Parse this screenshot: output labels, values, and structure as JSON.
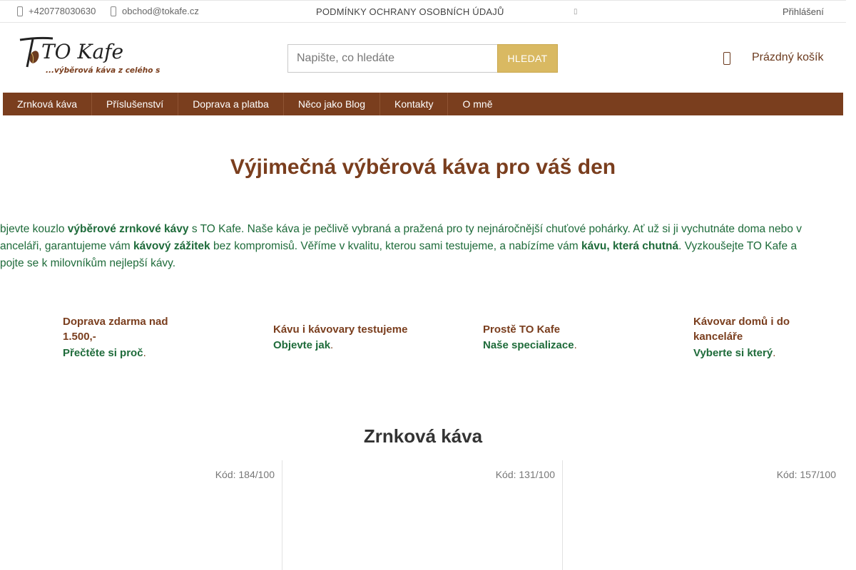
{
  "topbar": {
    "phone": "+420778030630",
    "email": "obchod@tokafe.cz",
    "privacy_link": "PODMÍNKY OCHRANY OSOBNÍCH ÚDAJŮ",
    "extra_icon": "▯",
    "login": "Přihlášení"
  },
  "header": {
    "logo_text": "TO Kafe",
    "logo_tagline": "...výběrová káva z celého světa",
    "search_placeholder": "Napište, co hledáte",
    "search_button": "HLEDAT",
    "cart_label": "Prázdný košík"
  },
  "nav": {
    "items": [
      "Zrnková káva",
      "Příslušenství",
      "Doprava a platba",
      "Něco jako Blog",
      "Kontakty",
      "O mně"
    ]
  },
  "hero": {
    "title": "Výjimečná výběrová káva pro váš den",
    "line1_a": "bjevte kouzlo ",
    "line1_b": "výběrové zrnkové kávy",
    "line1_c": " s TO Kafe. Naše káva je pečlivě vybraná a pražená pro ty nejnáročnější chuťové pohárky. Ať už si ji vychutnáte doma nebo v",
    "line2_a": "anceláři, garantujeme vám ",
    "line2_b": "kávový zážitek",
    "line2_c": " bez kompromisů. Věříme v kvalitu, kterou sami testujeme, a nabízíme vám ",
    "line2_d": "kávu, která chutná",
    "line2_e": ". Vyzkoušejte TO Kafe a",
    "line3": "pojte se k milovníkům nejlepší kávy."
  },
  "benefits": [
    {
      "title_1": "Doprava zdarma nad",
      "title_2": "1.500,-",
      "link": "Přečtěte si proč",
      "suffix": "."
    },
    {
      "title_1": "Kávu i kávovary testujeme",
      "link": "Objevte jak",
      "suffix": "."
    },
    {
      "title_1": "Prostě TO Kafe",
      "link": "Naše specializace",
      "suffix": "."
    },
    {
      "title_1": "Kávovar domů i do",
      "title_2": "kanceláře",
      "link": "Vyberte si který",
      "suffix": "."
    }
  ],
  "section": {
    "title": "Zrnková káva"
  },
  "products": [
    {
      "code": "Kód: 184/100"
    },
    {
      "code": "Kód: 131/100"
    },
    {
      "code": "Kód: 157/100"
    }
  ],
  "colors": {
    "brand_brown": "#7a3e1e",
    "brand_green": "#1e6b3a",
    "accent_gold": "#d9b962"
  }
}
